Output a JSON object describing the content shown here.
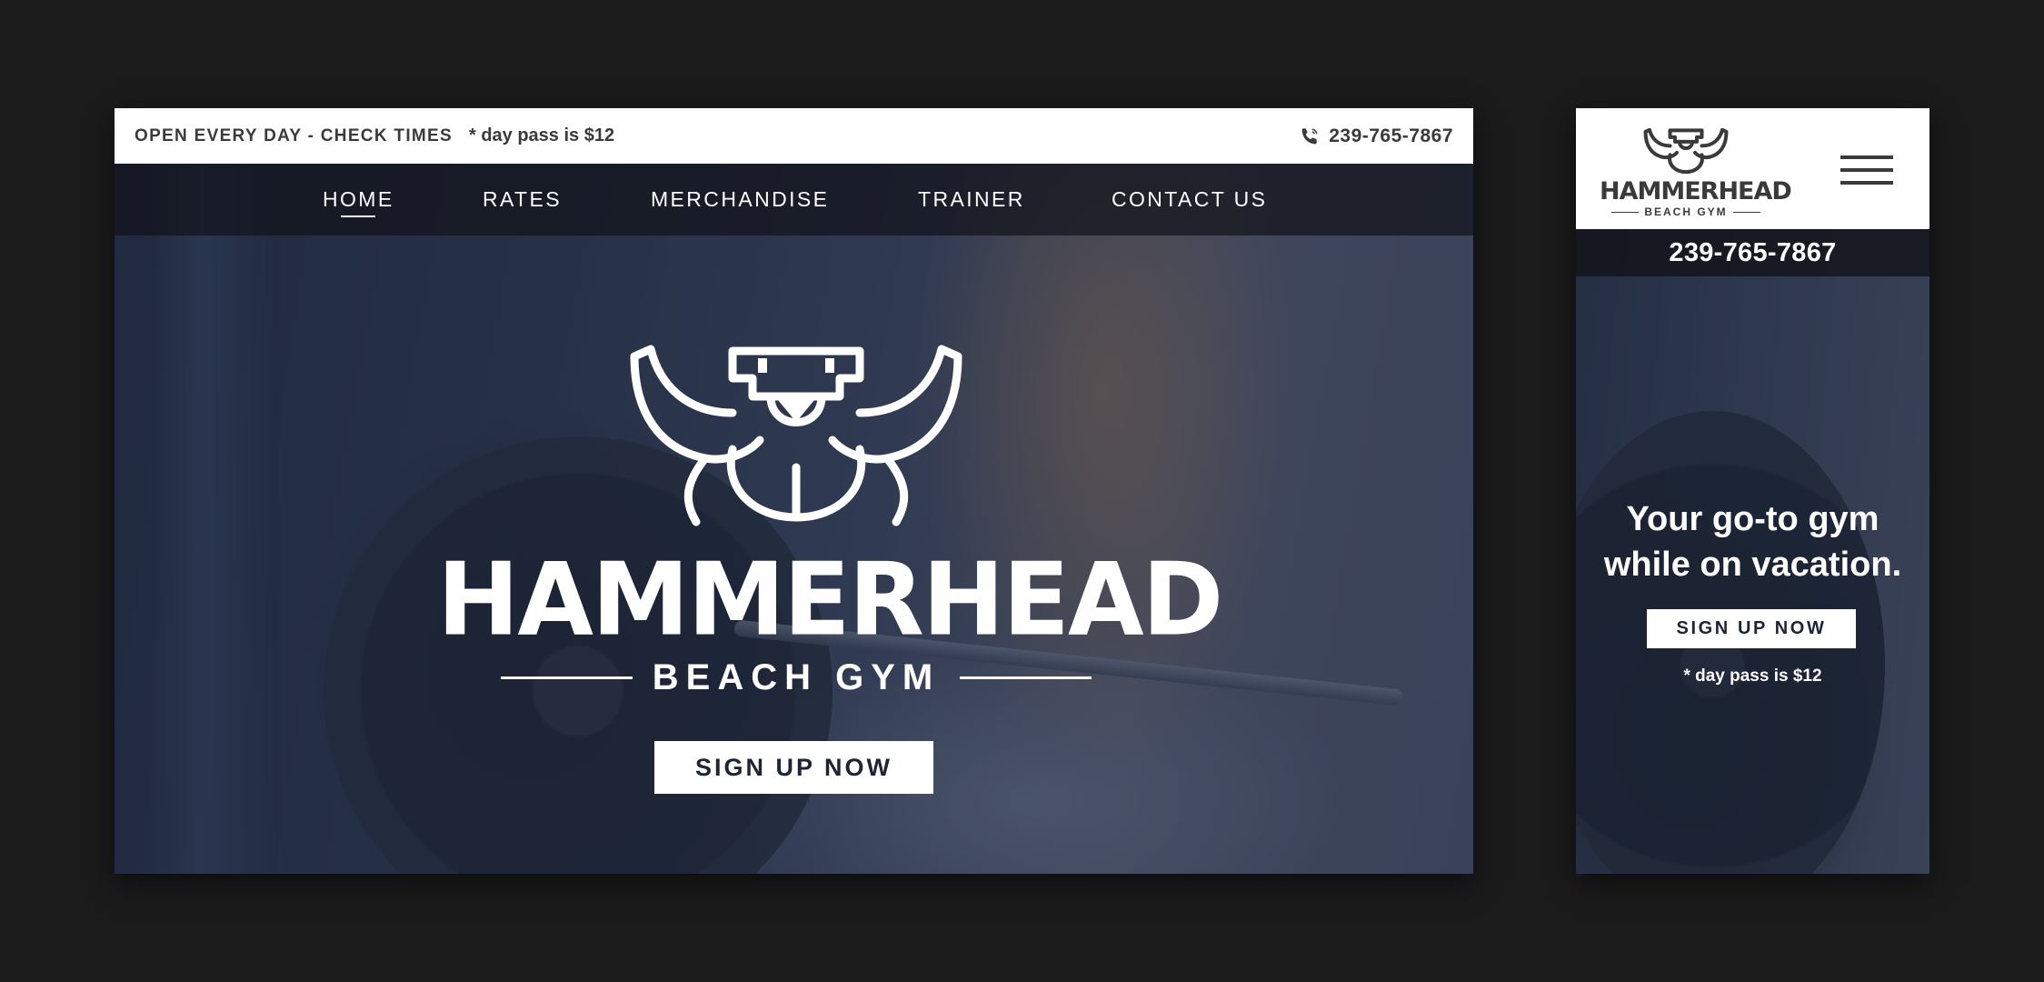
{
  "desktop": {
    "topbar": {
      "hours": "OPEN EVERY DAY - CHECK TIMES",
      "day_pass": "* day pass is $12",
      "phone": "239-765-7867",
      "phone_icon": "phone-icon"
    },
    "nav": {
      "items": [
        {
          "label": "HOME",
          "active": true
        },
        {
          "label": "RATES",
          "active": false
        },
        {
          "label": "MERCHANDISE",
          "active": false
        },
        {
          "label": "TRAINER",
          "active": false
        },
        {
          "label": "CONTACT US",
          "active": false
        }
      ]
    },
    "hero": {
      "brand_name": "HAMMERHEAD",
      "brand_sub": "BEACH GYM",
      "logo_icon": "muscle-hammerhead-icon",
      "cta_label": "SIGN UP NOW"
    }
  },
  "mobile": {
    "header": {
      "brand_name": "HAMMERHEAD",
      "brand_sub": "BEACH GYM",
      "logo_icon": "muscle-hammerhead-icon",
      "menu_icon": "hamburger-menu-icon"
    },
    "phone": "239-765-7867",
    "hero": {
      "headline_line1": "Your go-to gym",
      "headline_line2": "while on vacation.",
      "cta_label": "SIGN UP NOW",
      "day_pass": "* day pass is $12"
    }
  },
  "colors": {
    "background": "#1b1b1b",
    "white": "#ffffff",
    "text_dark": "#3a3a3a",
    "button_text": "#1d2433"
  }
}
